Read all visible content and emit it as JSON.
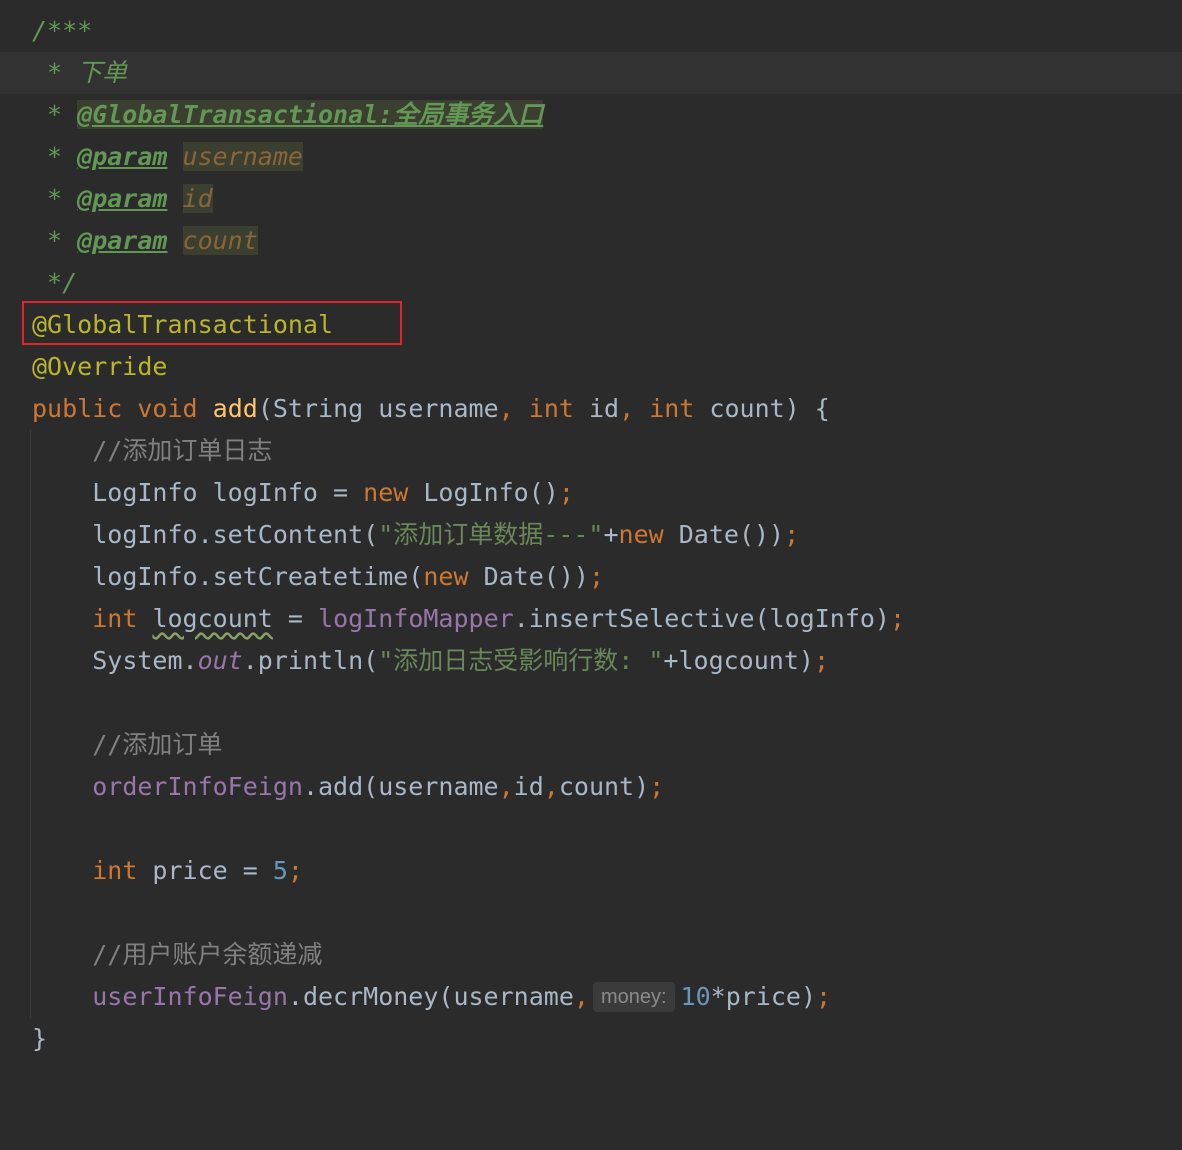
{
  "code": {
    "l1": "/***",
    "l2_star": " * ",
    "l2_text": "下单",
    "l3_star": " * ",
    "l3_tag": "@GlobalTransactional:全局事务入口",
    "l4_star": " * ",
    "l4_tag": "@param",
    "l4_name": "username",
    "l5_star": " * ",
    "l5_tag": "@param",
    "l5_name": "id",
    "l6_star": " * ",
    "l6_tag": "@param",
    "l6_name": "count",
    "l7": " */",
    "l8": "@GlobalTransactional",
    "l9": "@Override",
    "l10_kw1": "public",
    "l10_kw2": "void",
    "l10_fn": "add",
    "l10_p1": "(String username",
    "l10_kw3": "int",
    "l10_p2": " id",
    "l10_kw4": "int",
    "l10_p3": " count) {",
    "l11": "//添加订单日志",
    "l12_a": "LogInfo logInfo = ",
    "l12_kw": "new",
    "l12_b": " LogInfo()",
    "l13_a": "logInfo.setContent(",
    "l13_str": "\"添加订单数据---\"",
    "l13_b": "+",
    "l13_kw": "new",
    "l13_c": " Date())",
    "l14_a": "logInfo.setCreatetime(",
    "l14_kw": "new",
    "l14_b": " Date())",
    "l15_kw": "int",
    "l15_var": "logcount",
    "l15_a": " = ",
    "l15_field": "logInfoMapper",
    "l15_b": ".insertSelective(logInfo)",
    "l16_a": "System.",
    "l16_field": "out",
    "l16_b": ".println(",
    "l16_str": "\"添加日志受影响行数: \"",
    "l16_c": "+logcount)",
    "l18": "//添加订单",
    "l19_field": "orderInfoFeign",
    "l19_a": ".add(username",
    "l19_b": "id",
    "l19_c": "count)",
    "l21_kw": "int",
    "l21_a": " price = ",
    "l21_num": "5",
    "l23": "//用户账户余额递减",
    "l24_field": "userInfoFeign",
    "l24_a": ".decrMoney(username",
    "l24_hint": "money:",
    "l24_num": "10",
    "l24_b": "*price)",
    "l25": "}",
    "semicolon": ";",
    "comma": ","
  },
  "colors": {
    "background": "#2b2b2b",
    "keyword": "#cc7832",
    "annotation": "#bbb529",
    "doc_comment": "#629755",
    "string": "#6a8759",
    "field": "#9876aa",
    "number": "#6897bb",
    "highlight_box": "#e0262a"
  }
}
